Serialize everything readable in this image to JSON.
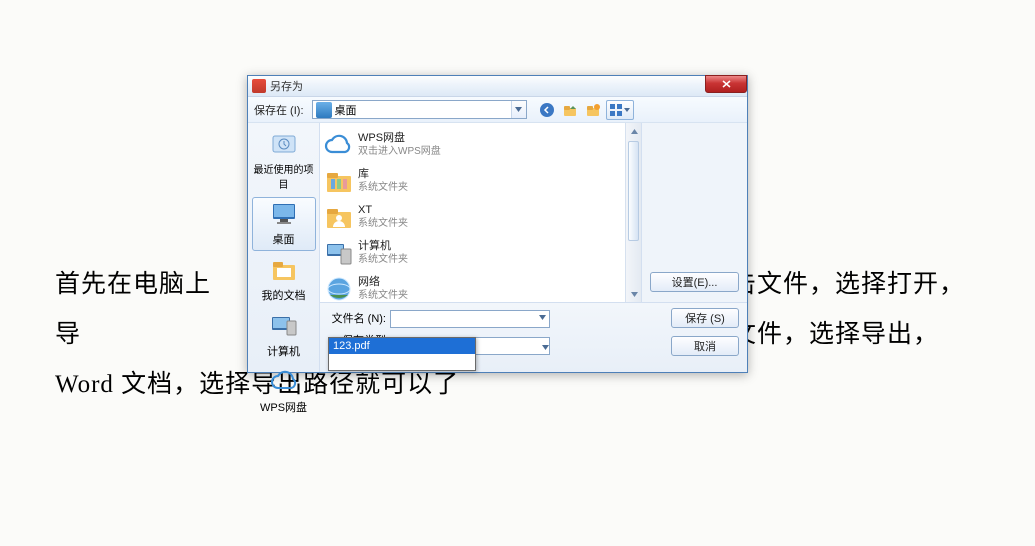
{
  "background_text": "首先在电脑上　　　　　　　　　　　　　　　　　上角点击文件，选择打开，导　　　　　　　　　　　　　　　　　　干始，再次点击文件，选择导出，Word 文档，选择导出路径就可以了",
  "dialog": {
    "title": "另存为",
    "save_in_label": "保存在 (I):",
    "location": "桌面",
    "sidebar": [
      {
        "label": "最近使用的项目"
      },
      {
        "label": "桌面"
      },
      {
        "label": "我的文档"
      },
      {
        "label": "计算机"
      },
      {
        "label": "WPS网盘"
      }
    ],
    "files": [
      {
        "name": "WPS网盘",
        "sub": "双击进入WPS网盘",
        "kind": "cloud"
      },
      {
        "name": "库",
        "sub": "系统文件夹",
        "kind": "library"
      },
      {
        "name": "XT",
        "sub": "系统文件夹",
        "kind": "user"
      },
      {
        "name": "计算机",
        "sub": "系统文件夹",
        "kind": "computer"
      },
      {
        "name": "网络",
        "sub": "系统文件夹",
        "kind": "network"
      }
    ],
    "settings_label": "设置(E)...",
    "filename_label": "文件名 (N):",
    "filename_value": "",
    "filetype_label": "保存类型 (T):",
    "filetype_value": "",
    "save_btn": "保存 (S)",
    "cancel_btn": "取消",
    "dropdown_item": "123.pdf"
  }
}
